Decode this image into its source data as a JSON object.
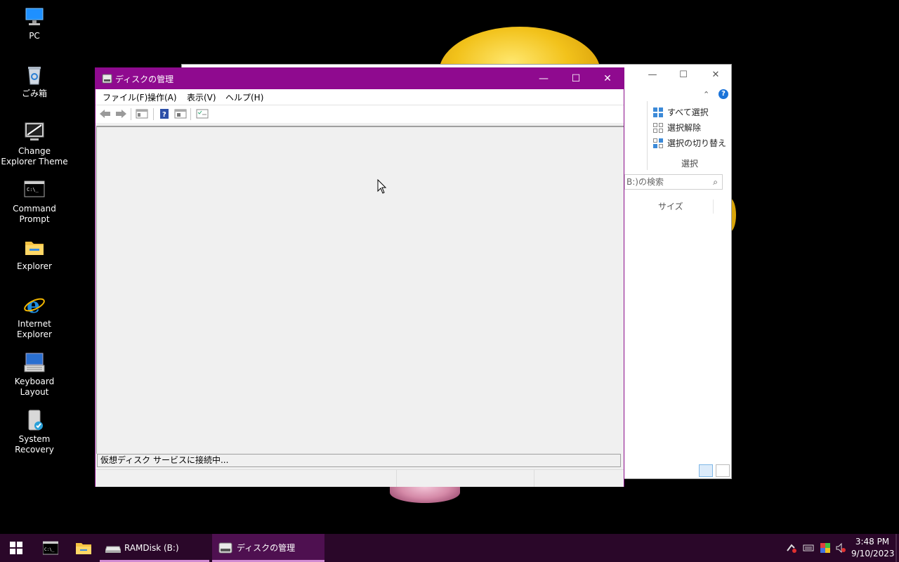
{
  "desktop": {
    "icons": [
      {
        "label": "PC",
        "icon": "pc-icon"
      },
      {
        "label": "ごみ箱",
        "icon": "recycle-bin-icon"
      },
      {
        "label": "Change Explorer Theme",
        "icon": "monitor-icon"
      },
      {
        "label": "Command Prompt",
        "icon": "command-prompt-icon"
      },
      {
        "label": "Explorer",
        "icon": "folder-icon"
      },
      {
        "label": "Internet Explorer",
        "icon": "internet-explorer-icon"
      },
      {
        "label": "Keyboard Layout",
        "icon": "keyboard-icon"
      },
      {
        "label": "System Recovery",
        "icon": "system-recovery-icon"
      }
    ]
  },
  "explorer": {
    "select_all": "すべて選択",
    "deselect": "選択解除",
    "invert_selection": "選択の切り替え",
    "group_label": "選択",
    "search_placeholder": "B:)の検索",
    "column_size": "サイズ"
  },
  "disk_management": {
    "title": "ディスクの管理",
    "menu": [
      "ファイル(F)",
      "操作(A)",
      "表示(V)",
      "ヘルプ(H)"
    ],
    "status": "仮想ディスク サービスに接続中..."
  },
  "taskbar": {
    "tasks": [
      {
        "label": "RAMDisk (B:)",
        "icon": "drive-icon"
      },
      {
        "label": "ディスクの管理",
        "icon": "disk-management-icon"
      }
    ],
    "time": "3:48 PM",
    "date": "9/10/2023"
  },
  "colors": {
    "title_bar": "#8f0a8f",
    "taskbar": "#2a0729",
    "active_task": "#4e1050"
  }
}
